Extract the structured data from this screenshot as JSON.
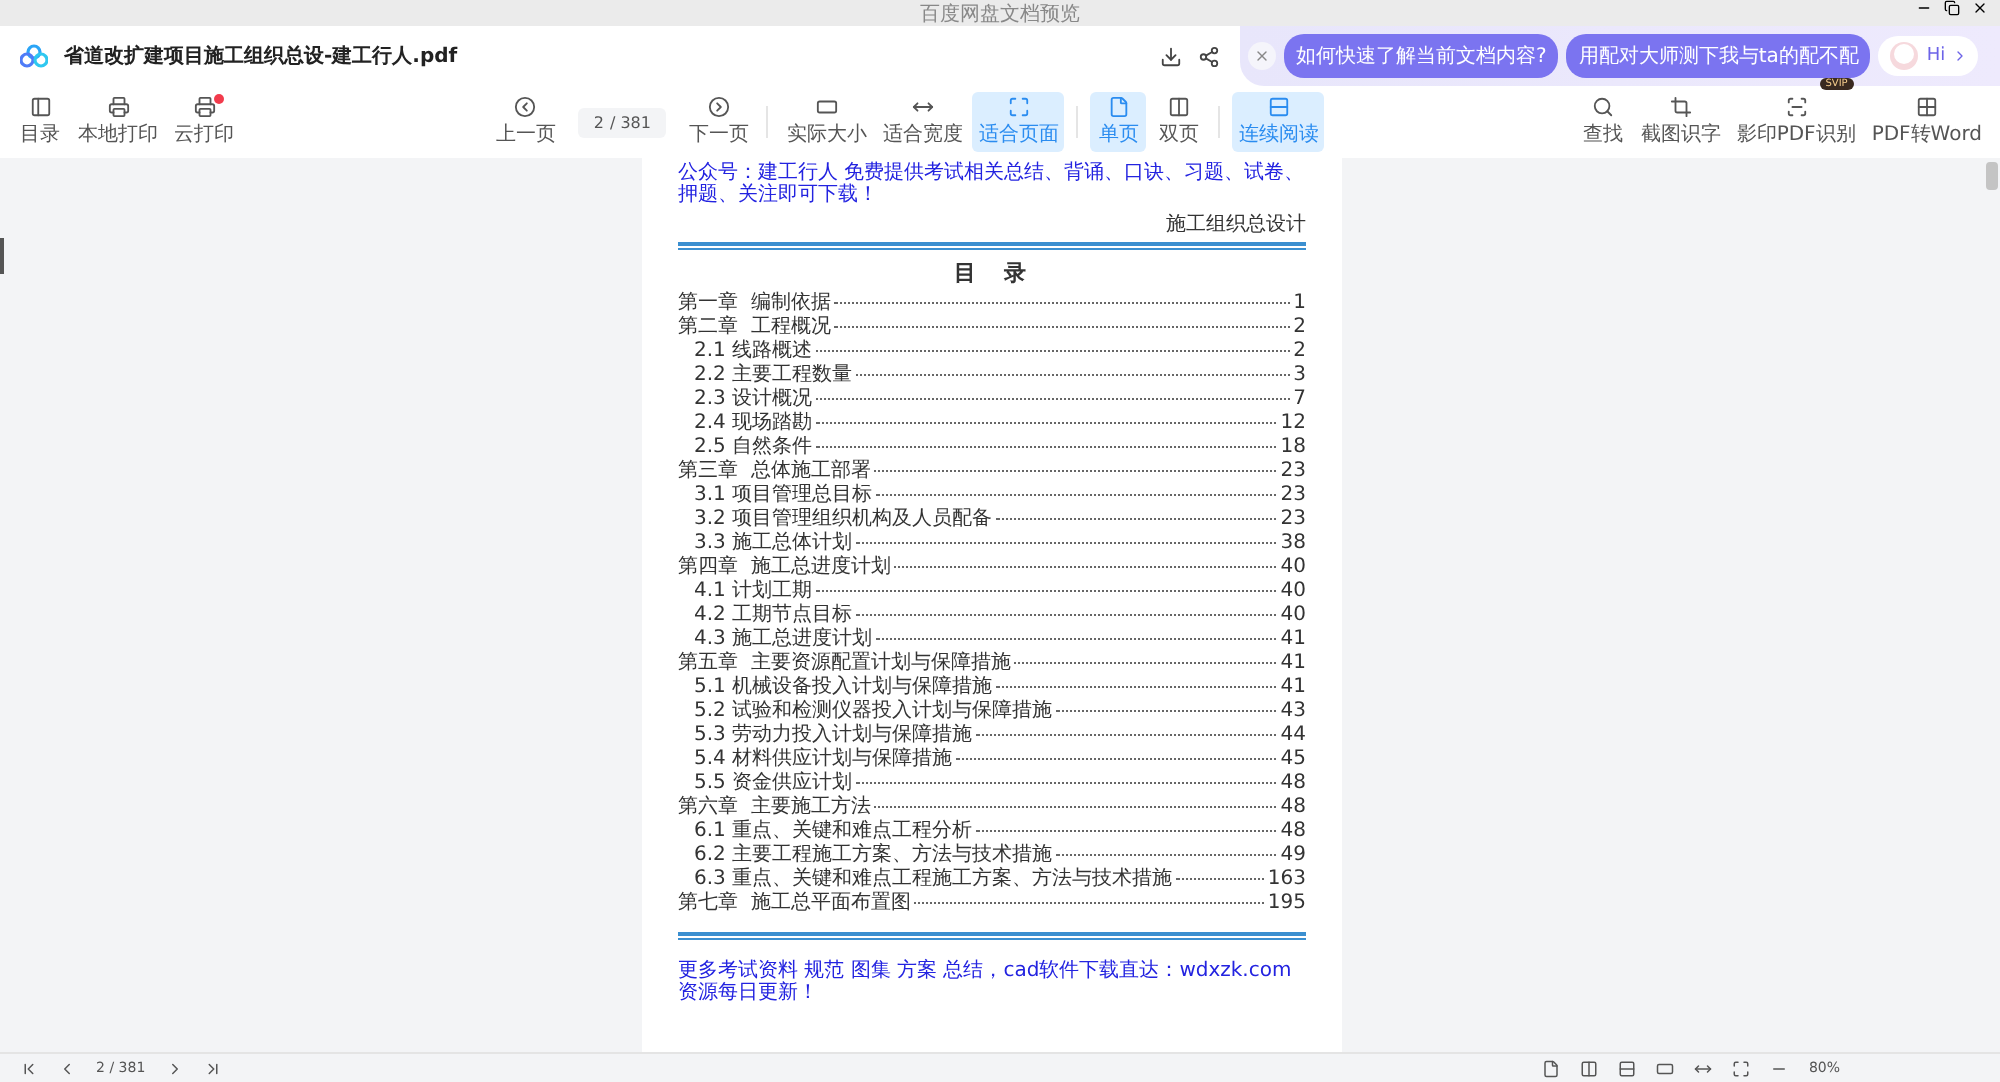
{
  "window": {
    "title": "百度网盘文档预览"
  },
  "header": {
    "file_name": "省道改扩建项目施工组织总设-建工行人.pdf"
  },
  "assistant": {
    "suggestions": [
      "如何快速了解当前文档内容?",
      "用配对大师测下我与ta的配不配"
    ],
    "greeting": "Hi"
  },
  "toolbar": {
    "left": [
      {
        "kind": "contents",
        "label": "目录",
        "dot": false
      },
      {
        "kind": "print",
        "label": "本地打印",
        "dot": false
      },
      {
        "kind": "cloud-print",
        "label": "云打印",
        "dot": true
      }
    ],
    "prev": "上一页",
    "next": "下一页",
    "page_field": {
      "value": "2",
      "total": "/ 381"
    },
    "views": [
      {
        "kind": "actual",
        "label": "实际大小",
        "selected": false
      },
      {
        "kind": "fit-width",
        "label": "适合宽度",
        "selected": false
      },
      {
        "kind": "fit-page",
        "label": "适合页面",
        "selected": true
      },
      {
        "kind": "single",
        "label": "单页",
        "selected": true
      },
      {
        "kind": "double",
        "label": "双页",
        "selected": false
      },
      {
        "kind": "continuous",
        "label": "连续阅读",
        "selected": true
      }
    ],
    "right": [
      {
        "kind": "search",
        "label": "查找"
      },
      {
        "kind": "crop",
        "label": "截图识字"
      },
      {
        "kind": "scan",
        "label": "影印PDF识别",
        "badge": "SVIP"
      },
      {
        "kind": "convert",
        "label": "PDF转Word"
      }
    ]
  },
  "document": {
    "notice": "公众号：建工行人 免费提供考试相关总结、背诵、口诀、习题、试卷、押题、关注即可下载！",
    "running_header": "施工组织总设计",
    "title": "目  录",
    "toc": [
      {
        "label": "第一章  编制依据",
        "page": "1"
      },
      {
        "label": "第二章  工程概况",
        "page": "2",
        "children": [
          {
            "label": "2.1 线路概述",
            "page": "2"
          },
          {
            "label": "2.2 主要工程数量",
            "page": "3"
          },
          {
            "label": "2.3 设计概况",
            "page": "7"
          },
          {
            "label": "2.4 现场踏勘",
            "page": "12"
          },
          {
            "label": "2.5 自然条件",
            "page": "18"
          }
        ]
      },
      {
        "label": "第三章  总体施工部署",
        "page": "23",
        "children": [
          {
            "label": "3.1 项目管理总目标",
            "page": "23"
          },
          {
            "label": "3.2 项目管理组织机构及人员配备",
            "page": "23"
          },
          {
            "label": "3.3 施工总体计划",
            "page": "38"
          }
        ]
      },
      {
        "label": "第四章  施工总进度计划",
        "page": "40",
        "children": [
          {
            "label": "4.1 计划工期",
            "page": "40"
          },
          {
            "label": "4.2 工期节点目标",
            "page": "40"
          },
          {
            "label": "4.3 施工总进度计划",
            "page": "41"
          }
        ]
      },
      {
        "label": "第五章  主要资源配置计划与保障措施",
        "page": "41",
        "children": [
          {
            "label": "5.1 机械设备投入计划与保障措施",
            "page": "41"
          },
          {
            "label": "5.2 试验和检测仪器投入计划与保障措施",
            "page": "43"
          },
          {
            "label": "5.3 劳动力投入计划与保障措施",
            "page": "44"
          },
          {
            "label": "5.4 材料供应计划与保障措施",
            "page": "45"
          },
          {
            "label": "5.5 资金供应计划",
            "page": "48"
          }
        ]
      },
      {
        "label": "第六章  主要施工方法",
        "page": "48",
        "children": [
          {
            "label": "6.1 重点、关键和难点工程分析",
            "page": "48"
          },
          {
            "label": "6.2 主要工程施工方案、方法与技术措施",
            "page": "49"
          },
          {
            "label": "6.3 重点、关键和难点工程施工方案、方法与技术措施",
            "page": "163"
          }
        ]
      },
      {
        "label": "第七章  施工总平面布置图",
        "page": "195"
      }
    ],
    "footer_notice": "更多考试资料 规范 图集 方案 总结，cad软件下载直达：wdxzk.com 资源每日更新！"
  },
  "bottom_bar": {
    "page_field": {
      "value": "2",
      "total": "/ 381"
    },
    "zoom": "80%"
  }
}
